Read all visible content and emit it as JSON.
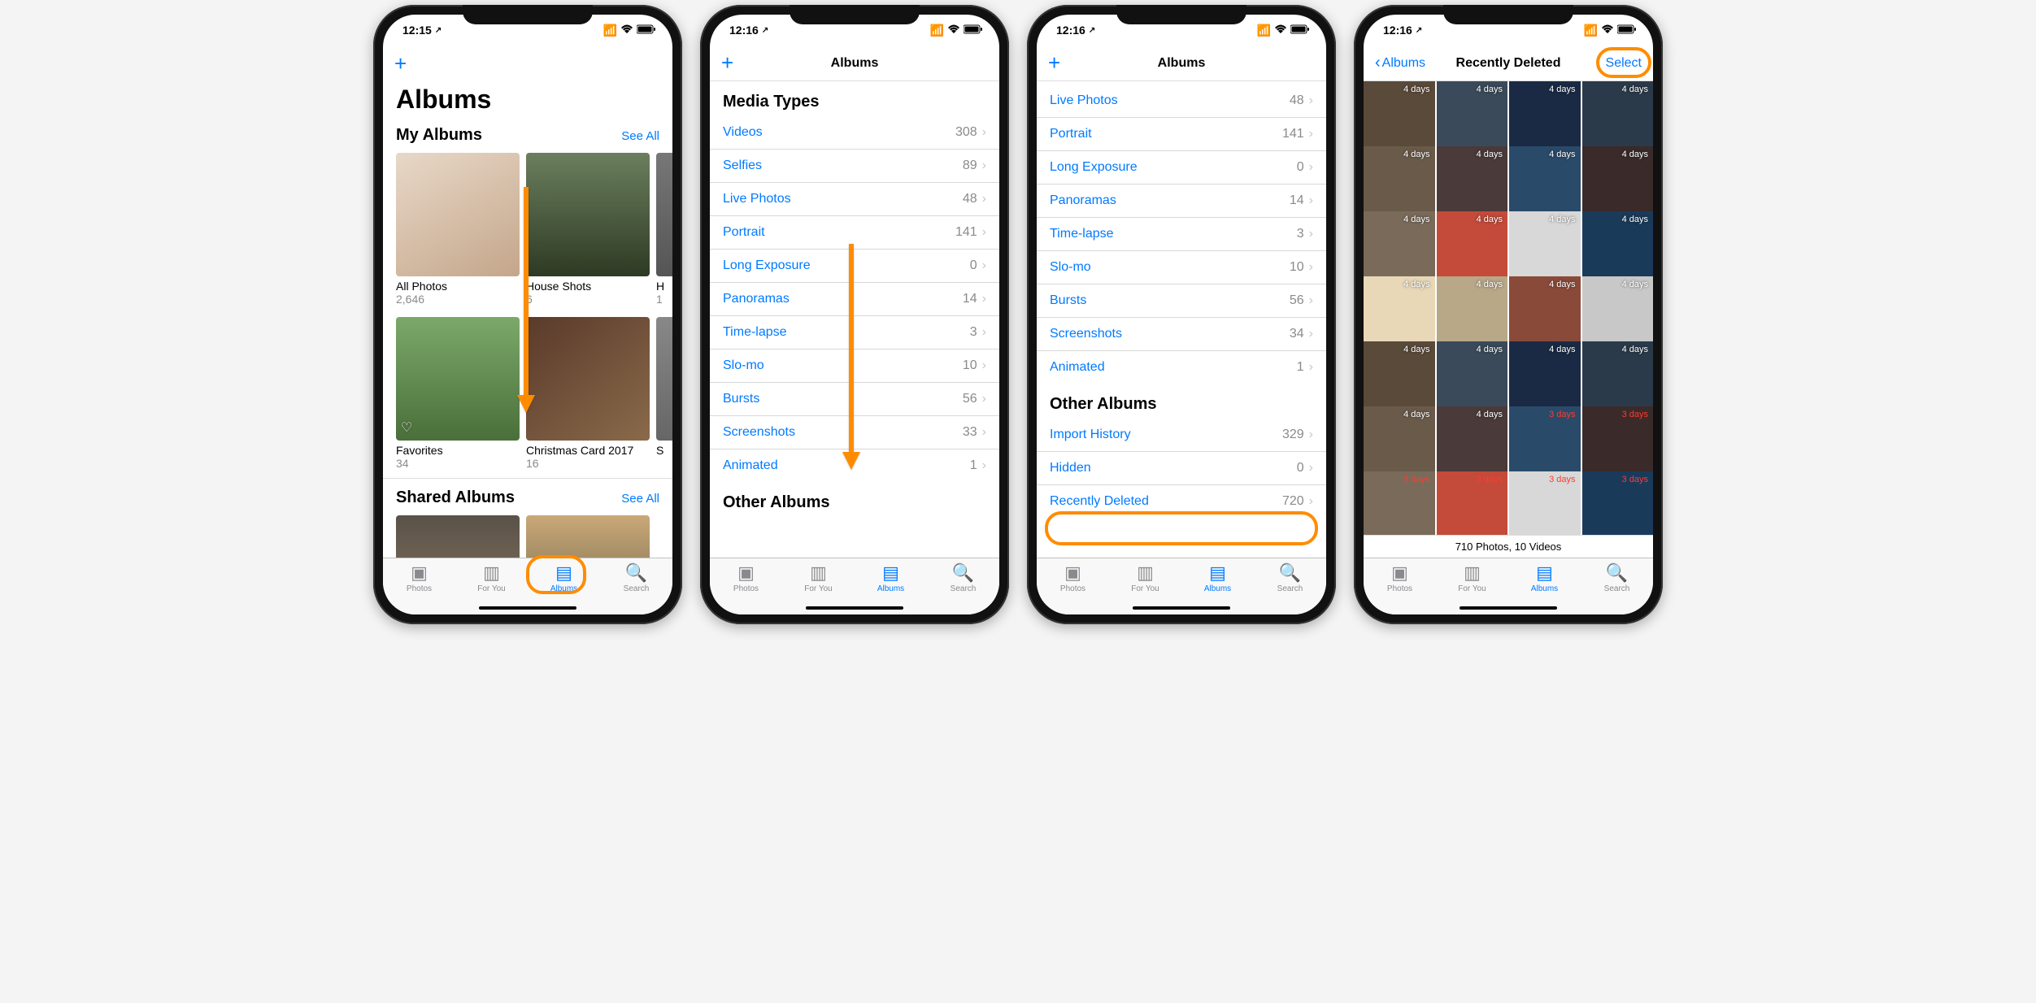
{
  "status": {
    "time1": "12:15",
    "time2": "12:16",
    "location_arrow": "➤"
  },
  "blue": "#007aff",
  "tabs": {
    "photos": "Photos",
    "for_you": "For You",
    "albums": "Albums",
    "search": "Search"
  },
  "s1": {
    "title": "Albums",
    "my_albums_header": "My Albums",
    "see_all": "See All",
    "albums_row1": [
      {
        "name": "All Photos",
        "count": "2,646"
      },
      {
        "name": "House Shots",
        "count": "6"
      },
      {
        "name": "H",
        "count": "1"
      }
    ],
    "albums_row2": [
      {
        "name": "Favorites",
        "count": "34"
      },
      {
        "name": "Christmas Card 2017",
        "count": "16"
      },
      {
        "name": "S",
        "count": ""
      }
    ],
    "shared_header": "Shared Albums"
  },
  "s2": {
    "nav_title": "Albums",
    "media_types_header": "Media Types",
    "rows": [
      {
        "label": "Videos",
        "count": "308"
      },
      {
        "label": "Selfies",
        "count": "89"
      },
      {
        "label": "Live Photos",
        "count": "48"
      },
      {
        "label": "Portrait",
        "count": "141"
      },
      {
        "label": "Long Exposure",
        "count": "0"
      },
      {
        "label": "Panoramas",
        "count": "14"
      },
      {
        "label": "Time-lapse",
        "count": "3"
      },
      {
        "label": "Slo-mo",
        "count": "10"
      },
      {
        "label": "Bursts",
        "count": "56"
      },
      {
        "label": "Screenshots",
        "count": "33"
      },
      {
        "label": "Animated",
        "count": "1"
      }
    ],
    "other_header": "Other Albums"
  },
  "s3": {
    "nav_title": "Albums",
    "media_rows": [
      {
        "label": "Live Photos",
        "count": "48"
      },
      {
        "label": "Portrait",
        "count": "141"
      },
      {
        "label": "Long Exposure",
        "count": "0"
      },
      {
        "label": "Panoramas",
        "count": "14"
      },
      {
        "label": "Time-lapse",
        "count": "3"
      },
      {
        "label": "Slo-mo",
        "count": "10"
      },
      {
        "label": "Bursts",
        "count": "56"
      },
      {
        "label": "Screenshots",
        "count": "34"
      },
      {
        "label": "Animated",
        "count": "1"
      }
    ],
    "other_header": "Other Albums",
    "other_rows": [
      {
        "label": "Import History",
        "count": "329"
      },
      {
        "label": "Hidden",
        "count": "0"
      },
      {
        "label": "Recently Deleted",
        "count": "720"
      }
    ]
  },
  "s4": {
    "back": "Albums",
    "title": "Recently Deleted",
    "select": "Select",
    "summary": "710 Photos, 10 Videos",
    "days_rows": [
      [
        "4 days",
        "4 days",
        "4 days",
        "4 days"
      ],
      [
        "4 days",
        "4 days",
        "4 days",
        "4 days"
      ],
      [
        "4 days",
        "4 days",
        "4 days",
        "4 days"
      ],
      [
        "4 days",
        "4 days",
        "4 days",
        "4 days"
      ],
      [
        "4 days",
        "4 days",
        "4 days",
        "4 days"
      ],
      [
        "4 days",
        "4 days",
        "3 days",
        "3 days"
      ],
      [
        "3 days",
        "3 days",
        "3 days",
        "3 days"
      ]
    ],
    "red_cells": [
      "5-2",
      "5-3",
      "6-0",
      "6-1",
      "6-2",
      "6-3"
    ]
  }
}
